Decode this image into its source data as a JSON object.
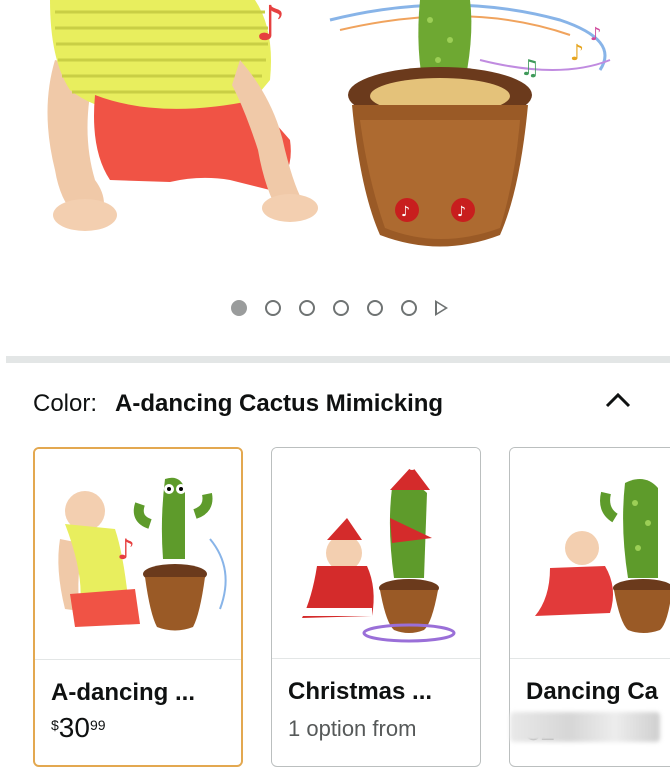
{
  "gallery": {
    "image_count": 6,
    "active_index": 0
  },
  "color_selector": {
    "label": "Color:",
    "selected_value": "A-dancing Cactus Mimicking",
    "collapse_icon": "chevron-up-icon"
  },
  "swatches": [
    {
      "title": "A-dancing ...",
      "price_symbol": "$",
      "price_whole": "30",
      "price_fraction": "99"
    },
    {
      "title": "Christmas ...",
      "subtitle": "1 option from"
    },
    {
      "title": "Dancing Ca",
      "subtitle": "32"
    }
  ],
  "colors": {
    "selected_border": "#e3a850",
    "border": "#bbbfbf",
    "divider": "#e3e6e6"
  }
}
